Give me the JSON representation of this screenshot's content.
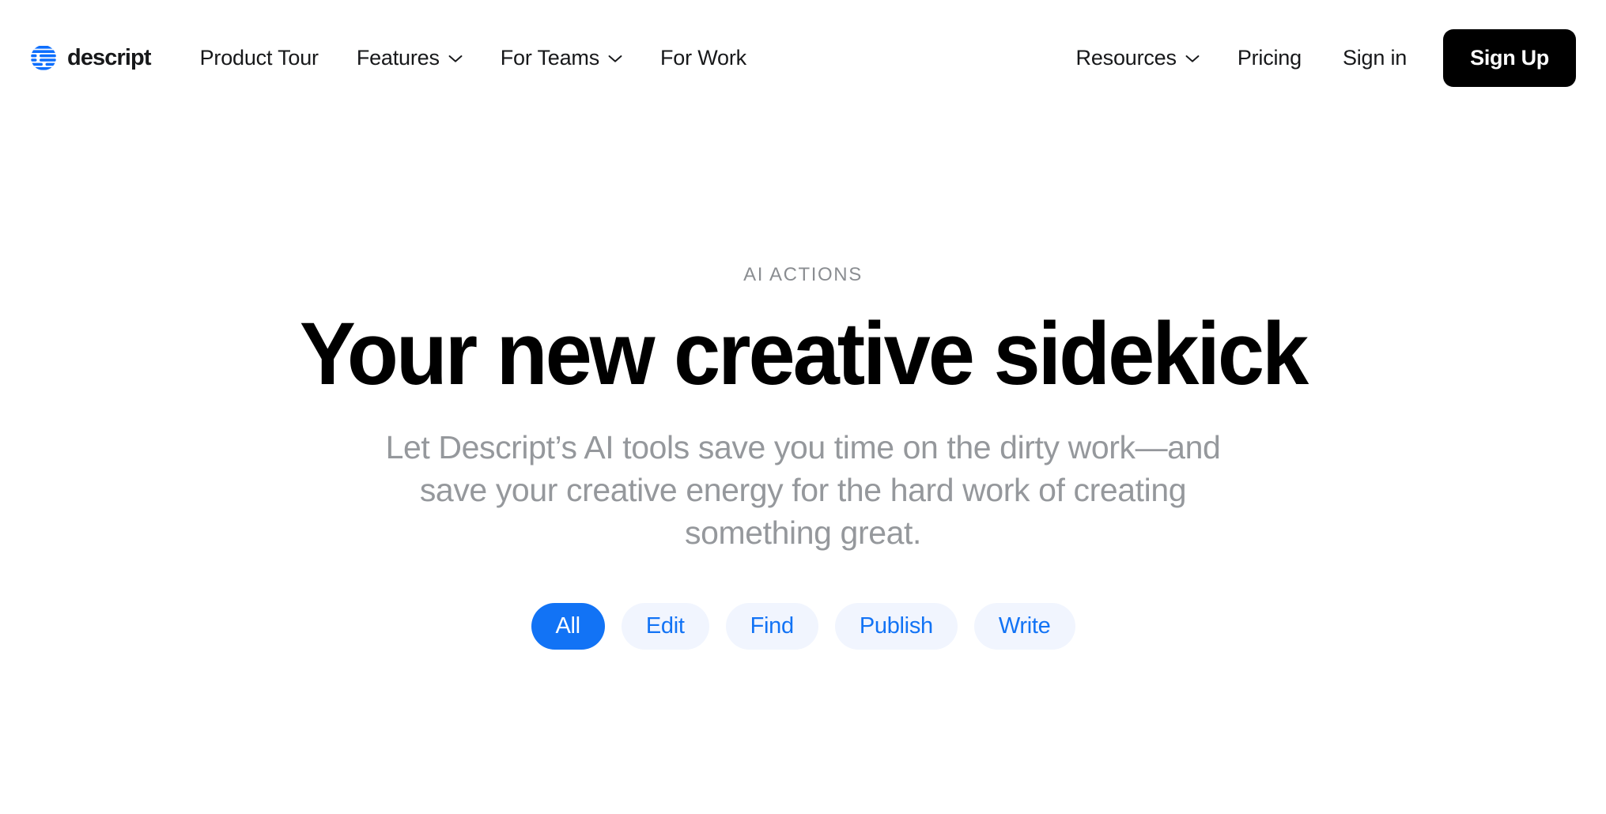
{
  "brand": {
    "name": "descript",
    "logo_icon": "descript-logo-mark",
    "logo_color": "#0D6EFD"
  },
  "nav": {
    "left_items": [
      {
        "label": "Product Tour",
        "has_dropdown": false
      },
      {
        "label": "Features",
        "has_dropdown": true,
        "icon": "chevron-down-icon"
      },
      {
        "label": "For Teams",
        "has_dropdown": true,
        "icon": "chevron-down-icon"
      },
      {
        "label": "For Work",
        "has_dropdown": false
      }
    ],
    "right_items": [
      {
        "label": "Resources",
        "has_dropdown": true,
        "icon": "chevron-down-icon"
      },
      {
        "label": "Pricing",
        "has_dropdown": false
      }
    ],
    "signin_label": "Sign in",
    "signup_label": "Sign Up",
    "signup_bg": "#000000",
    "signup_fg": "#FFFFFF"
  },
  "hero": {
    "eyebrow": "AI ACTIONS",
    "headline": "Your new creative sidekick",
    "subhead": "Let Descript’s AI tools save you time on the dirty work—and save your creative energy for the hard work of creating something great.",
    "eyebrow_color": "#8A8D91",
    "headline_color": "#000000",
    "subhead_color": "#95989C"
  },
  "filters": {
    "active_index": 0,
    "active_bg": "#1273F5",
    "active_fg": "#FFFFFF",
    "inactive_bg": "#F1F5FE",
    "inactive_fg": "#1273F5",
    "items": [
      {
        "label": "All"
      },
      {
        "label": "Edit"
      },
      {
        "label": "Find"
      },
      {
        "label": "Publish"
      },
      {
        "label": "Write"
      }
    ]
  }
}
